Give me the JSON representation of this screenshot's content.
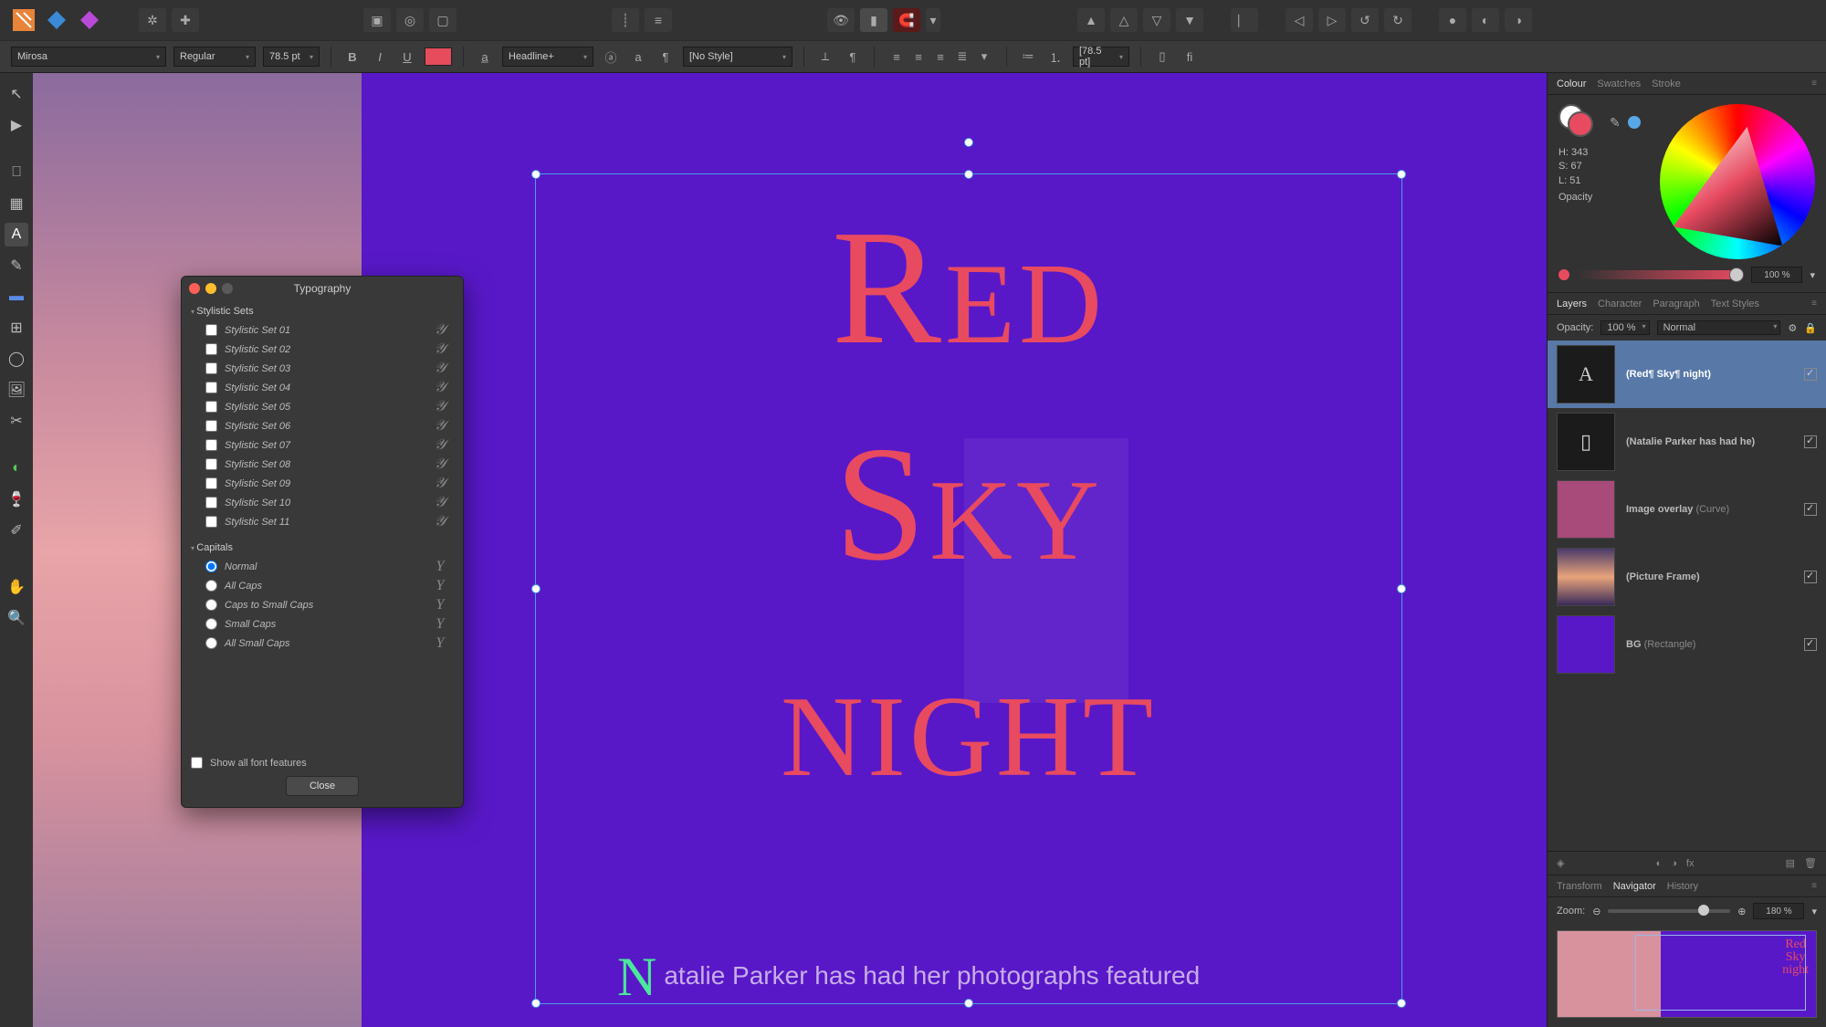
{
  "context_toolbar": {
    "font_family": "Mirosa",
    "font_weight": "Regular",
    "font_size": "78.5 pt",
    "paragraph_style": "Headline+",
    "text_style": "[No Style]",
    "leading": "[78.5 pt]",
    "fill_color": "#e74c5c"
  },
  "canvas": {
    "title_line1": "Red",
    "title_line2": "Sky",
    "title_line3": "night",
    "body_dropcap": "N",
    "body_text": "atalie Parker has had her photographs featured"
  },
  "typography_panel": {
    "title": "Typography",
    "stylistic_sets_header": "Stylistic Sets",
    "sets": [
      "Stylistic Set 01",
      "Stylistic Set 02",
      "Stylistic Set 03",
      "Stylistic Set 04",
      "Stylistic Set 05",
      "Stylistic Set 06",
      "Stylistic Set 07",
      "Stylistic Set 08",
      "Stylistic Set 09",
      "Stylistic Set 10",
      "Stylistic Set 11"
    ],
    "capitals_header": "Capitals",
    "capitals": [
      "Normal",
      "All Caps",
      "Caps to Small Caps",
      "Small Caps",
      "All Small Caps"
    ],
    "capitals_selected": "Normal",
    "show_all_label": "Show all font features",
    "close_label": "Close"
  },
  "colour_panel": {
    "tabs": [
      "Colour",
      "Swatches",
      "Stroke"
    ],
    "active_tab": "Colour",
    "H": "H: 343",
    "S": "S: 67",
    "L": "L: 51",
    "opacity_label": "Opacity",
    "opacity_value": "100 %"
  },
  "layers_panel": {
    "tabs": [
      "Layers",
      "Character",
      "Paragraph",
      "Text Styles"
    ],
    "active_tab": "Layers",
    "opacity_label": "Opacity:",
    "opacity_value": "100 %",
    "blend_mode": "Normal",
    "items": [
      {
        "name": "(Red¶ Sky¶ night)",
        "aux": "",
        "thumb": "A",
        "thumb_bg": "#1b1b1b",
        "selected": true
      },
      {
        "name": "(Natalie Parker has had he)",
        "aux": "",
        "thumb": "▯",
        "thumb_bg": "#1b1b1b",
        "selected": false
      },
      {
        "name": "Image overlay ",
        "aux": "(Curve)",
        "thumb": "",
        "thumb_bg": "#a84a7a",
        "selected": false
      },
      {
        "name": "(Picture Frame)",
        "aux": "",
        "thumb": "",
        "thumb_bg": "linear",
        "selected": false
      },
      {
        "name": "BG ",
        "aux": "(Rectangle)",
        "thumb": "",
        "thumb_bg": "#5818c8",
        "selected": false
      }
    ]
  },
  "navigator_panel": {
    "tabs": [
      "Transform",
      "Navigator",
      "History"
    ],
    "active_tab": "Navigator",
    "zoom_label": "Zoom:",
    "zoom_value": "180 %"
  }
}
